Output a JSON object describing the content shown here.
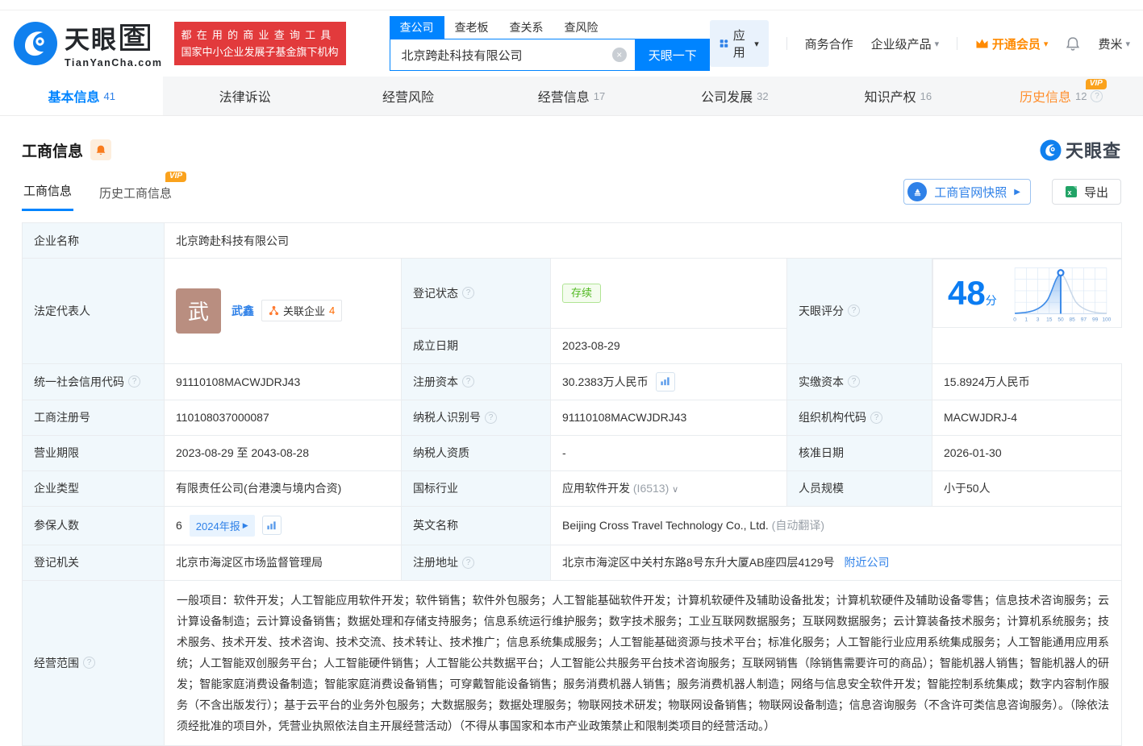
{
  "colors": {
    "brand_blue": "#0084ff",
    "link_blue": "#2f81e8",
    "orange": "#ff8a00",
    "red": "#e23a3c",
    "green": "#50b820"
  },
  "icons": {
    "help": "?",
    "clear": "×",
    "chevron_down": "▾",
    "caret_down": "∨",
    "arrow_right": "▶",
    "vip": "VIP"
  },
  "header": {
    "brand": "天眼",
    "brand_boxed": "查",
    "domain": "TianYanCha.com",
    "slogan_line1": "都在用的商业查询工具",
    "slogan_line2": "国家中小企业发展子基金旗下机构",
    "search_tabs": [
      {
        "label": "查公司"
      },
      {
        "label": "查老板"
      },
      {
        "label": "查关系"
      },
      {
        "label": "查风险"
      }
    ],
    "search_value": "北京跨赴科技有限公司",
    "search_button": "天眼一下",
    "nav_apps": "应用",
    "nav_coop": "商务合作",
    "nav_enterprise": "企业级产品",
    "nav_vip": "开通会员",
    "nav_user": "费米"
  },
  "tabs": [
    {
      "label": "基本信息",
      "count": "41"
    },
    {
      "label": "法律诉讼",
      "count": ""
    },
    {
      "label": "经营风险",
      "count": ""
    },
    {
      "label": "经营信息",
      "count": "17"
    },
    {
      "label": "公司发展",
      "count": "32"
    },
    {
      "label": "知识产权",
      "count": "16"
    },
    {
      "label": "历史信息",
      "count": "12"
    }
  ],
  "section": {
    "title": "工商信息",
    "subtab_current": "工商信息",
    "subtab_history": "历史工商信息",
    "snapshot_button": "工商官网快照",
    "export_button": "导出",
    "watermark": "天眼查"
  },
  "table": {
    "company_name": {
      "label": "企业名称",
      "value": "北京跨赴科技有限公司"
    },
    "legal_rep": {
      "label": "法定代表人",
      "avatar": "武",
      "name": "武鑫",
      "related_label": "关联企业",
      "related_count": "4"
    },
    "reg_status": {
      "label": "登记状态",
      "value": "存续"
    },
    "establish_date": {
      "label": "成立日期",
      "value": "2023-08-29"
    },
    "score": {
      "label": "天眼评分",
      "value": "48",
      "unit": "分",
      "ticks": [
        "0",
        "1",
        "3",
        "15",
        "50",
        "85",
        "97",
        "99",
        "100"
      ]
    },
    "credit_code": {
      "label": "统一社会信用代码",
      "value": "91110108MACWJDRJ43"
    },
    "reg_capital": {
      "label": "注册资本",
      "value": "30.2383万人民币"
    },
    "paid_capital": {
      "label": "实缴资本",
      "value": "15.8924万人民币"
    },
    "reg_number": {
      "label": "工商注册号",
      "value": "110108037000087"
    },
    "taxpayer_id": {
      "label": "纳税人识别号",
      "value": "91110108MACWJDRJ43"
    },
    "org_code": {
      "label": "组织机构代码",
      "value": "MACWJDRJ-4"
    },
    "business_term": {
      "label": "营业期限",
      "value": "2023-08-29 至 2043-08-28"
    },
    "taxpayer_quality": {
      "label": "纳税人资质",
      "value": "-"
    },
    "approval_date": {
      "label": "核准日期",
      "value": "2026-01-30"
    },
    "company_type": {
      "label": "企业类型",
      "value": "有限责任公司(台港澳与境内合资)"
    },
    "industry": {
      "label": "国标行业",
      "value": "应用软件开发",
      "code": "(I6513)"
    },
    "staff_size": {
      "label": "人员规模",
      "value": "小于50人"
    },
    "insured": {
      "label": "参保人数",
      "value": "6",
      "report_badge": "2024年报"
    },
    "english_name": {
      "label": "英文名称",
      "value": "Beijing Cross Travel Technology Co., Ltd.",
      "note": "(自动翻译)"
    },
    "reg_authority": {
      "label": "登记机关",
      "value": "北京市海淀区市场监督管理局"
    },
    "reg_address": {
      "label": "注册地址",
      "value": "北京市海淀区中关村东路8号东升大厦AB座四层4129号",
      "link": "附近公司"
    },
    "business_scope": {
      "label": "经营范围",
      "value": "一般项目：软件开发；人工智能应用软件开发；软件销售；软件外包服务；人工智能基础软件开发；计算机软硬件及辅助设备批发；计算机软硬件及辅助设备零售；信息技术咨询服务；云计算设备制造；云计算设备销售；数据处理和存储支持服务；信息系统运行维护服务；数字技术服务；工业互联网数据服务；互联网数据服务；云计算装备技术服务；计算机系统服务；技术服务、技术开发、技术咨询、技术交流、技术转让、技术推广；信息系统集成服务；人工智能基础资源与技术平台；标准化服务；人工智能行业应用系统集成服务；人工智能通用应用系统；人工智能双创服务平台；人工智能硬件销售；人工智能公共数据平台；人工智能公共服务平台技术咨询服务；互联网销售（除销售需要许可的商品）；智能机器人销售；智能机器人的研发；智能家庭消费设备制造；智能家庭消费设备销售；可穿戴智能设备销售；服务消费机器人销售；服务消费机器人制造；网络与信息安全软件开发；智能控制系统集成；数字内容制作服务（不含出版发行）；基于云平台的业务外包服务；大数据服务；数据处理服务；物联网技术研发；物联网设备销售；物联网设备制造；信息咨询服务（不含许可类信息咨询服务）。（除依法须经批准的项目外，凭营业执照依法自主开展经营活动）（不得从事国家和本市产业政策禁止和限制类项目的经营活动。）"
    }
  }
}
